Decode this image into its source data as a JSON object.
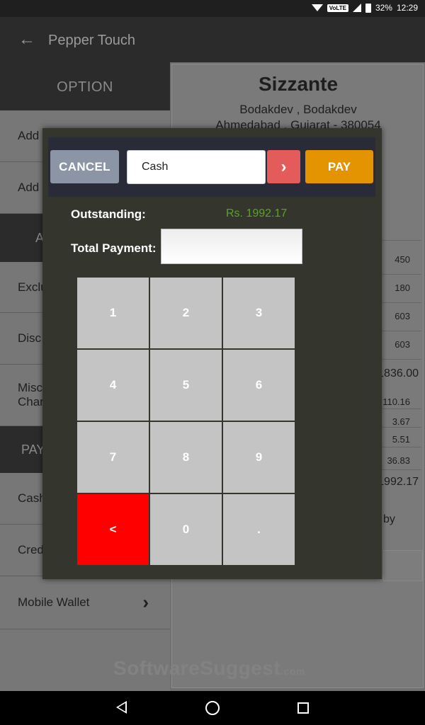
{
  "status_bar": {
    "volte": "VoLTE",
    "battery": "32%",
    "time": "12:29"
  },
  "app_bar": {
    "title": "Pepper Touch"
  },
  "left_panel": {
    "header": "OPTION",
    "rows": [
      {
        "label": "Add",
        "type": "row"
      },
      {
        "label": "Add",
        "type": "row"
      },
      {
        "label": "A",
        "type": "dark"
      },
      {
        "label": "Exclu",
        "type": "row"
      },
      {
        "label": "Disc",
        "type": "row"
      },
      {
        "label": "Misc Char",
        "type": "row"
      },
      {
        "label": "PAY",
        "type": "dark"
      },
      {
        "label": "Cash",
        "type": "row"
      },
      {
        "label": "Cred",
        "type": "row"
      },
      {
        "label": "Mobile Wallet",
        "type": "row"
      }
    ]
  },
  "receipt": {
    "name": "Sizzante",
    "address_line1": "Bodakdev , Bodakdev",
    "address_line2": "Ahmedabad , Gujarat - 380054",
    "values": [
      "450",
      "180",
      "603",
      "603",
      "1836.00",
      "110.16",
      "3.67",
      "5.51",
      "36.83",
      "1992.17"
    ],
    "by_text": "by"
  },
  "watermark": {
    "main": "SoftwareSuggest",
    "suffix": ".com"
  },
  "dialog": {
    "cancel_label": "CANCEL",
    "payment_method": "Cash",
    "next_icon": "chevron-right-icon",
    "pay_label": "PAY",
    "outstanding_label": "Outstanding:",
    "outstanding_value": "Rs. 1992.17",
    "total_payment_label": "Total Payment:",
    "total_payment_value": "",
    "keys": [
      "1",
      "2",
      "3",
      "4",
      "5",
      "6",
      "7",
      "8",
      "9",
      "<",
      "0",
      "."
    ]
  },
  "colors": {
    "cancel": "#8b95a6",
    "next": "#e35b5b",
    "pay": "#e39400",
    "outstanding": "#5aa22a",
    "delete_key": "#ff0000",
    "key": "#c4c4c4"
  }
}
